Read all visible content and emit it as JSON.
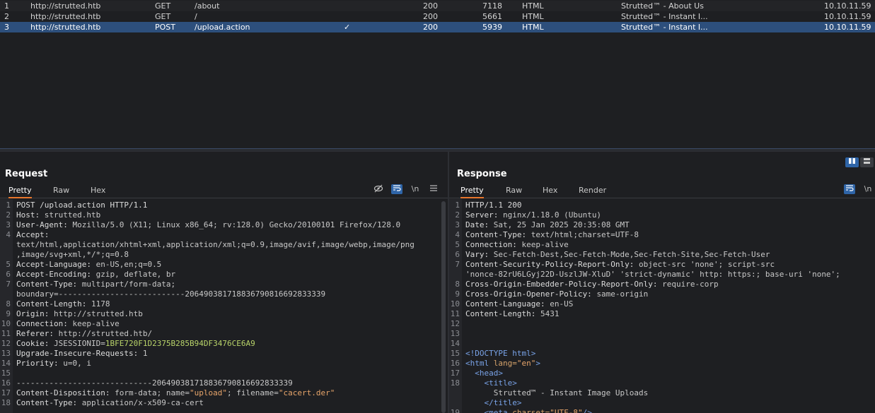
{
  "history": {
    "rows": [
      {
        "num": "1",
        "host": "http://strutted.htb",
        "method": "GET",
        "url": "/about",
        "params": "",
        "status": "200",
        "length": "7118",
        "mime": "HTML",
        "title": "Strutted™ - About Us",
        "ip": "10.10.11.59"
      },
      {
        "num": "2",
        "host": "http://strutted.htb",
        "method": "GET",
        "url": "/",
        "params": "",
        "status": "200",
        "length": "5661",
        "mime": "HTML",
        "title": "Strutted™ - Instant I...",
        "ip": "10.10.11.59"
      },
      {
        "num": "3",
        "host": "http://strutted.htb",
        "method": "POST",
        "url": "/upload.action",
        "params": "✓",
        "status": "200",
        "length": "5939",
        "mime": "HTML",
        "title": "Strutted™ - Instant I...",
        "ip": "10.10.11.59"
      }
    ]
  },
  "request": {
    "title": "Request",
    "tabs": [
      "Pretty",
      "Raw",
      "Hex"
    ],
    "tools": {
      "hide_icon": "eye-off-icon",
      "wrap_icon": "wrap-lines-icon",
      "newline": "\\n",
      "menu_icon": "hamburger-menu-icon"
    },
    "lines": [
      {
        "n": "1",
        "k": "POST /upload.action HTTP/1.1",
        "v": ""
      },
      {
        "n": "2",
        "k": "Host: ",
        "v": "strutted.htb"
      },
      {
        "n": "3",
        "k": "User-Agent: ",
        "v": "Mozilla/5.0 (X11; Linux x86_64; rv:128.0) Gecko/20100101 Firefox/128.0"
      },
      {
        "n": "4",
        "k": "Accept: ",
        "v": ""
      },
      {
        "n": "",
        "k": "",
        "v": "text/html,application/xhtml+xml,application/xml;q=0.9,image/avif,image/webp,image/png"
      },
      {
        "n": "",
        "k": "",
        "v": ",image/svg+xml,*/*;q=0.8"
      },
      {
        "n": "5",
        "k": "Accept-Language: ",
        "v": "en-US,en;q=0.5"
      },
      {
        "n": "6",
        "k": "Accept-Encoding: ",
        "v": "gzip, deflate, br"
      },
      {
        "n": "7",
        "k": "Content-Type: ",
        "v": "multipart/form-data;"
      },
      {
        "n": "",
        "k": "",
        "v": "boundary=---------------------------206490381718836790816692833339"
      },
      {
        "n": "8",
        "k": "Content-Length: ",
        "v": "1178"
      },
      {
        "n": "9",
        "k": "Origin: ",
        "v": "http://strutted.htb"
      },
      {
        "n": "10",
        "k": "Connection: ",
        "v": "keep-alive"
      },
      {
        "n": "11",
        "k": "Referer: ",
        "v": "http://strutted.htb/"
      },
      {
        "n": "12",
        "k": "Cookie: ",
        "v": "JSESSIONID=",
        "g": "1BFE720F1D2375B285B94DF3476CE6A9"
      },
      {
        "n": "13",
        "k": "Upgrade-Insecure-Requests: ",
        "v": "1"
      },
      {
        "n": "14",
        "k": "Priority: ",
        "v": "u=0, i"
      },
      {
        "n": "15",
        "k": "",
        "v": ""
      },
      {
        "n": "16",
        "k": "",
        "v": "-----------------------------206490381718836790816692833339"
      },
      {
        "n": "17",
        "k": "Content-Disposition: ",
        "v": "form-data; name=",
        "s1": "\"upload\"",
        "v2": "; filename=",
        "s2": "\"cacert.der\""
      },
      {
        "n": "18",
        "k": "Content-Type: ",
        "v": "application/x-x509-ca-cert"
      }
    ]
  },
  "response": {
    "title": "Response",
    "tabs": [
      "Pretty",
      "Raw",
      "Hex",
      "Render"
    ],
    "tools": {
      "wrap_icon": "wrap-lines-icon",
      "newline": "\\n"
    },
    "lines": [
      {
        "n": "1",
        "k": "HTTP/1.1 200",
        "v": ""
      },
      {
        "n": "2",
        "k": "Server: ",
        "v": "nginx/1.18.0 (Ubuntu)"
      },
      {
        "n": "3",
        "k": "Date: ",
        "v": "Sat, 25 Jan 2025 20:35:08 GMT"
      },
      {
        "n": "4",
        "k": "Content-Type: ",
        "v": "text/html;charset=UTF-8"
      },
      {
        "n": "5",
        "k": "Connection: ",
        "v": "keep-alive"
      },
      {
        "n": "6",
        "k": "Vary: ",
        "v": "Sec-Fetch-Dest,Sec-Fetch-Mode,Sec-Fetch-Site,Sec-Fetch-User"
      },
      {
        "n": "7",
        "k": "Content-Security-Policy-Report-Only: ",
        "v": "object-src 'none'; script-src"
      },
      {
        "n": "",
        "k": "",
        "v": "'nonce-82rU6LGyj22D-UszlJW-XluD' 'strict-dynamic' http: https:; base-uri 'none';"
      },
      {
        "n": "8",
        "k": "Cross-Origin-Embedder-Policy-Report-Only: ",
        "v": "require-corp"
      },
      {
        "n": "9",
        "k": "Cross-Origin-Opener-Policy: ",
        "v": "same-origin"
      },
      {
        "n": "10",
        "k": "Content-Language: ",
        "v": "en-US"
      },
      {
        "n": "11",
        "k": "Content-Length: ",
        "v": "5431"
      },
      {
        "n": "12",
        "k": "",
        "v": ""
      },
      {
        "n": "13",
        "k": "",
        "v": ""
      },
      {
        "n": "14",
        "k": "",
        "v": ""
      },
      {
        "n": "15",
        "k": "",
        "v": "",
        "tag": "<!DOCTYPE html>"
      },
      {
        "n": "16",
        "k": "",
        "v": "",
        "tag": "<html ",
        "attr": "lang=",
        "s": "\"en\"",
        "tag2": ">"
      },
      {
        "n": "17",
        "k": "",
        "v": "",
        "indent": "  ",
        "tag": "<head>"
      },
      {
        "n": "18",
        "k": "",
        "v": "",
        "indent": "    ",
        "tag": "<title>"
      },
      {
        "n": "",
        "k": "",
        "v": "      Strutted™ - Instant Image Uploads"
      },
      {
        "n": "",
        "k": "",
        "v": "",
        "indent": "    ",
        "tag": "</title>"
      },
      {
        "n": "19",
        "k": "",
        "v": "",
        "indent": "    ",
        "tag": "<meta ",
        "attr": "charset=",
        "s": "\"UTF-8\"",
        "tag2": "/>"
      }
    ]
  }
}
